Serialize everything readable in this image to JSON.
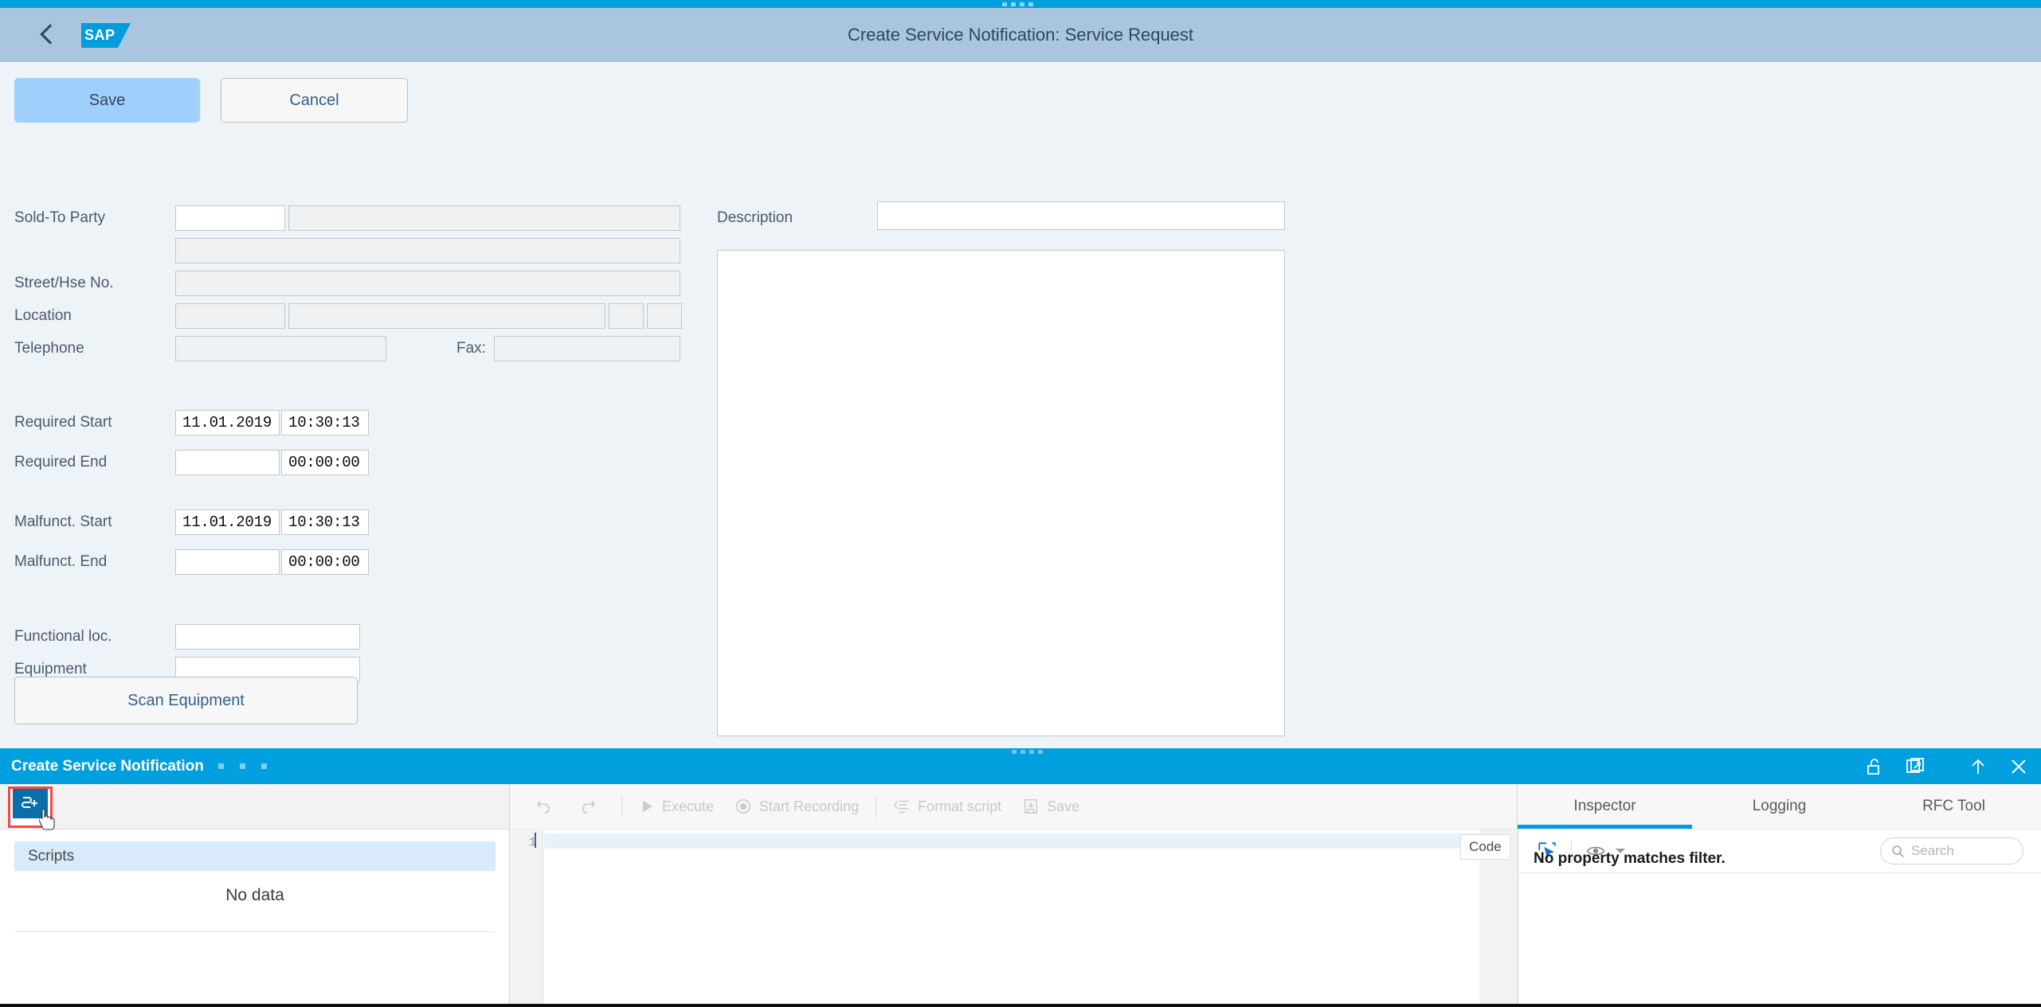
{
  "shell": {
    "title": "Create Service Notification: Service Request",
    "logo_text": "SAP",
    "back_label": "Back"
  },
  "actions": {
    "save_label": "Save",
    "cancel_label": "Cancel"
  },
  "form": {
    "left_fields": [
      {
        "label": "Sold-To Party",
        "value": ""
      },
      {
        "label": "",
        "value": ""
      },
      {
        "label": "Street/Hse No.",
        "value": ""
      },
      {
        "label": "Location",
        "value": ""
      },
      {
        "label": "Telephone",
        "value": "",
        "fax_label": "Fax:",
        "fax_value": ""
      }
    ],
    "date_rows": [
      {
        "label": "Required Start",
        "date": "11.01.2019",
        "time": "10:30:13"
      },
      {
        "label": "Required End",
        "date": "",
        "time": "00:00:00"
      },
      {
        "label": "Malfunct. Start",
        "date": "11.01.2019",
        "time": "10:30:13"
      },
      {
        "label": "Malfunct. End",
        "date": "",
        "time": "00:00:00"
      }
    ],
    "equipment_fields": [
      {
        "label": "Functional loc.",
        "value": ""
      },
      {
        "label": "Equipment",
        "value": ""
      }
    ],
    "scan_button_label": "Scan Equipment",
    "description_label": "Description",
    "description_value": "",
    "description_long_text": ""
  },
  "tool_panel": {
    "title": "Create Service Notification",
    "header_icons": [
      {
        "name": "unlock-icon"
      },
      {
        "name": "popout-window-icon"
      },
      {
        "name": "maximize-up-icon"
      },
      {
        "name": "close-icon"
      }
    ],
    "scripts": {
      "add_script_icon": "add-script-icon",
      "column_header": "Scripts",
      "empty_text": "No data"
    },
    "editor": {
      "toolbar": [
        {
          "name": "undo-icon",
          "label": ""
        },
        {
          "name": "redo-icon",
          "label": ""
        },
        {
          "name": "play-icon",
          "label": "Execute"
        },
        {
          "name": "record-icon",
          "label": "Start Recording"
        },
        {
          "name": "format-script-icon",
          "label": "Format script"
        },
        {
          "name": "save-icon",
          "label": "Save"
        }
      ],
      "line_number": "1",
      "content": ""
    },
    "inspector": {
      "tabs": [
        {
          "label": "Inspector",
          "active": true
        },
        {
          "label": "Logging",
          "active": false
        },
        {
          "label": "RFC Tool",
          "active": false
        }
      ],
      "code_tooltip": "Code",
      "select_element_icon": "select-element-icon",
      "visibility_icon": "eye-icon",
      "search_placeholder": "Search",
      "search_value": "",
      "empty_message": "No property matches filter."
    }
  },
  "colors": {
    "brand_blue": "#00a0df",
    "header_blue": "#a9c6de",
    "save_blue": "#9fd0fb",
    "accent_red": "#f4454a",
    "form_bg": "#eef3f7"
  }
}
